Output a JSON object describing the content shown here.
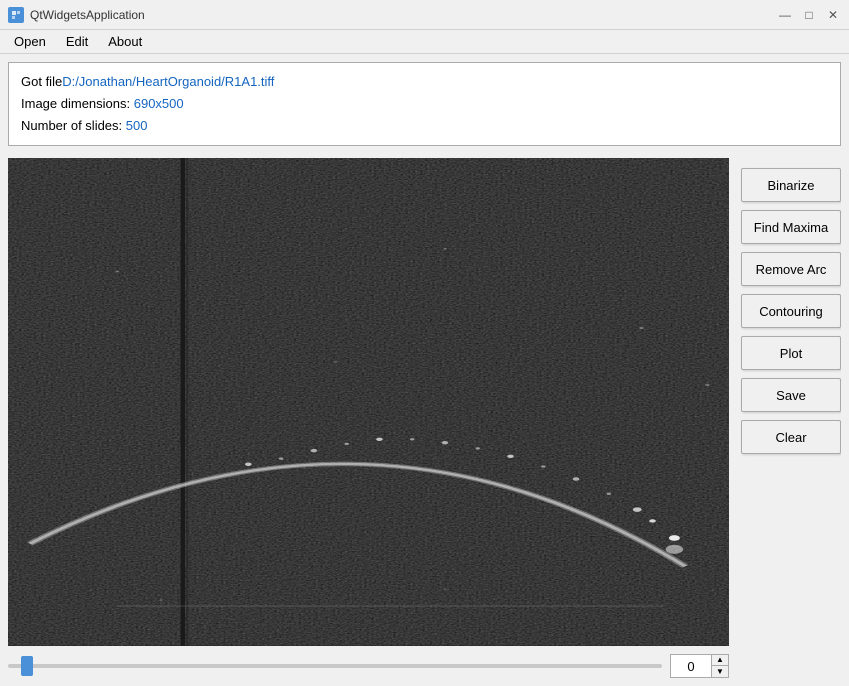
{
  "window": {
    "title": "QtWidgetsApplication",
    "icon": "app-icon"
  },
  "title_controls": {
    "minimize": "—",
    "maximize": "□",
    "close": "✕"
  },
  "menu": {
    "items": [
      {
        "id": "open",
        "label": "Open"
      },
      {
        "id": "edit",
        "label": "Edit"
      },
      {
        "id": "about",
        "label": "About"
      }
    ]
  },
  "info": {
    "line1_prefix": "Got file",
    "line1_value": "D:/Jonathan/HeartOrganoid/R1A1.tiff",
    "line2_prefix": "Image dimensions: ",
    "line2_value": "690x500",
    "line3_prefix": "Number of slides: ",
    "line3_value": "500"
  },
  "buttons": [
    {
      "id": "binarize",
      "label": "Binarize"
    },
    {
      "id": "find-maxima",
      "label": "Find Maxima"
    },
    {
      "id": "remove-arc",
      "label": "Remove Arc"
    },
    {
      "id": "contouring",
      "label": "Contouring"
    },
    {
      "id": "plot",
      "label": "Plot"
    },
    {
      "id": "save",
      "label": "Save"
    },
    {
      "id": "clear",
      "label": "Clear"
    }
  ],
  "slider": {
    "value": "0",
    "min": 0,
    "max": 500
  }
}
